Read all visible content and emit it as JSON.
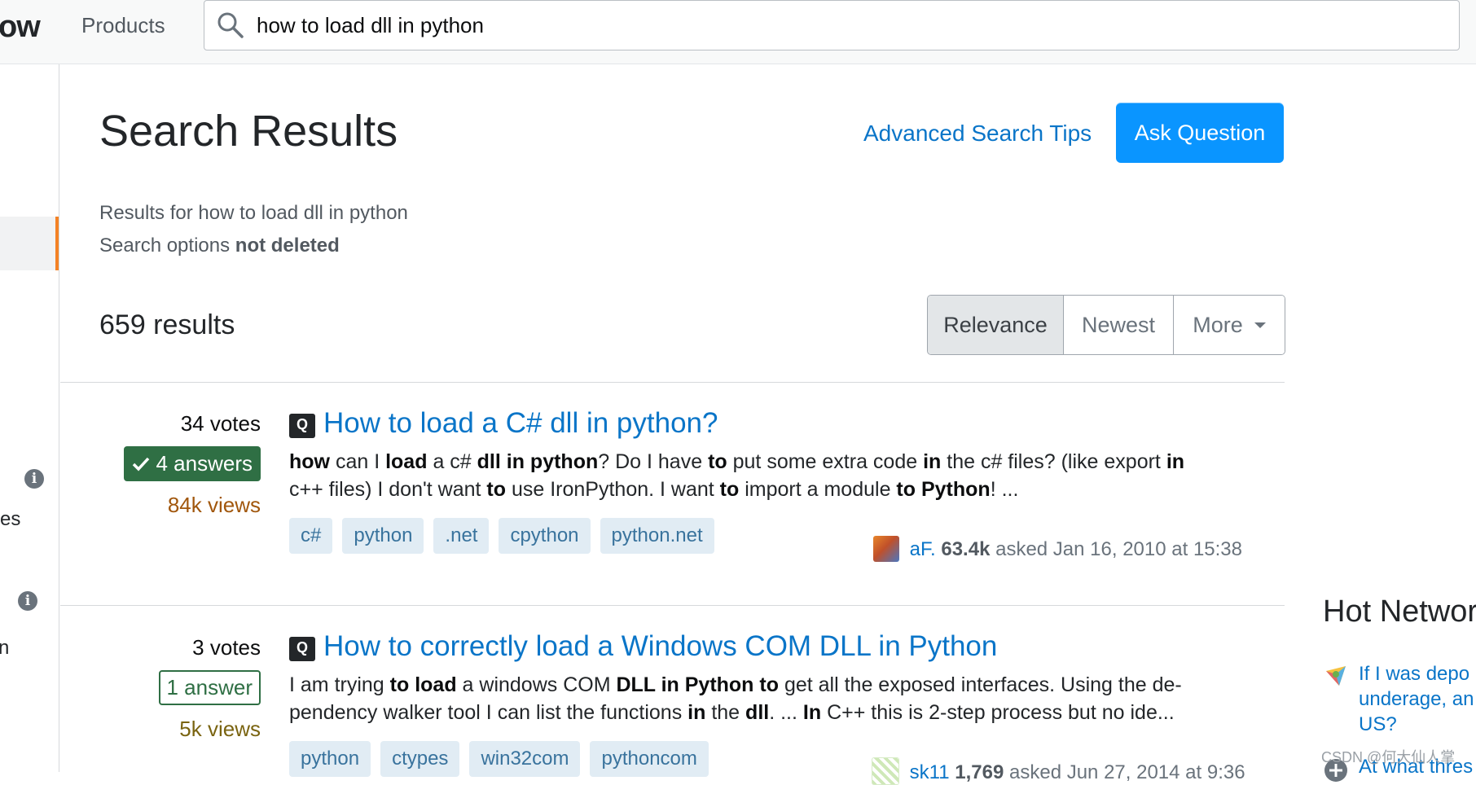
{
  "topbar": {
    "logo_fragment": "ow",
    "products_label": "Products",
    "search_value": "how to load dll in python"
  },
  "leftnav": {
    "fragment_1": "es",
    "fragment_2": "n"
  },
  "header": {
    "title": "Search Results",
    "advanced_tips_label": "Advanced Search Tips",
    "ask_question_label": "Ask Question",
    "results_for_prefix": "Results for",
    "results_for_query": "how to load dll in python",
    "search_options_prefix": "Search options",
    "search_options_value": "not deleted",
    "result_count": "659 results"
  },
  "sort": {
    "relevance": "Relevance",
    "newest": "Newest",
    "more": "More"
  },
  "results": [
    {
      "votes": "34 votes",
      "answers": "4 answers",
      "answer_accepted": true,
      "views": "84k views",
      "title": "How to load a C# dll in python?",
      "excerpt_line_1": "how can I load a c# dll in python? Do I have to put some extra code in the c# files? (like export in",
      "excerpt_line_2": "c++ files) I don't want to use IronPython. I want to import a module to Python! ...",
      "tags": [
        "c#",
        "python",
        ".net",
        "cpython",
        "python.net"
      ],
      "author": "aF.",
      "reputation": "63.4k",
      "asked": "asked Jan 16, 2010 at 15:38"
    },
    {
      "votes": "3 votes",
      "answers": "1 answer",
      "answer_accepted": false,
      "views": "5k views",
      "title": "How to correctly load a Windows COM DLL in Python",
      "excerpt_line_1": "I am trying to load a windows COM DLL in Python to get all the exposed interfaces. Using the de-",
      "excerpt_line_2": "pendency walker tool I can list the functions in the dll. ... In C++ this is 2-step process but no ide...",
      "tags": [
        "python",
        "ctypes",
        "win32com",
        "pythoncom"
      ],
      "author": "sk11",
      "reputation": "1,769",
      "asked": "asked Jun 27, 2014 at 9:36"
    }
  ],
  "sidebar": {
    "hot_network_title": "Hot Networ",
    "hot_items": [
      {
        "line_1": "If I was depo",
        "line_2": "underage, an",
        "line_3": "US?"
      },
      {
        "line_1": "At what thres"
      }
    ]
  },
  "watermark": "CSDN @何大仙人掌",
  "colors": {
    "accent_orange": "#f48225",
    "link_blue": "#0a75c8",
    "button_blue": "#0a95ff",
    "accepted_green": "#2f6f44",
    "tag_bg": "#e1ecf4",
    "tag_text": "#39739d"
  },
  "icons": {
    "search": "search-icon",
    "info": "info-icon",
    "question": "question-icon",
    "check": "checkmark-icon"
  }
}
